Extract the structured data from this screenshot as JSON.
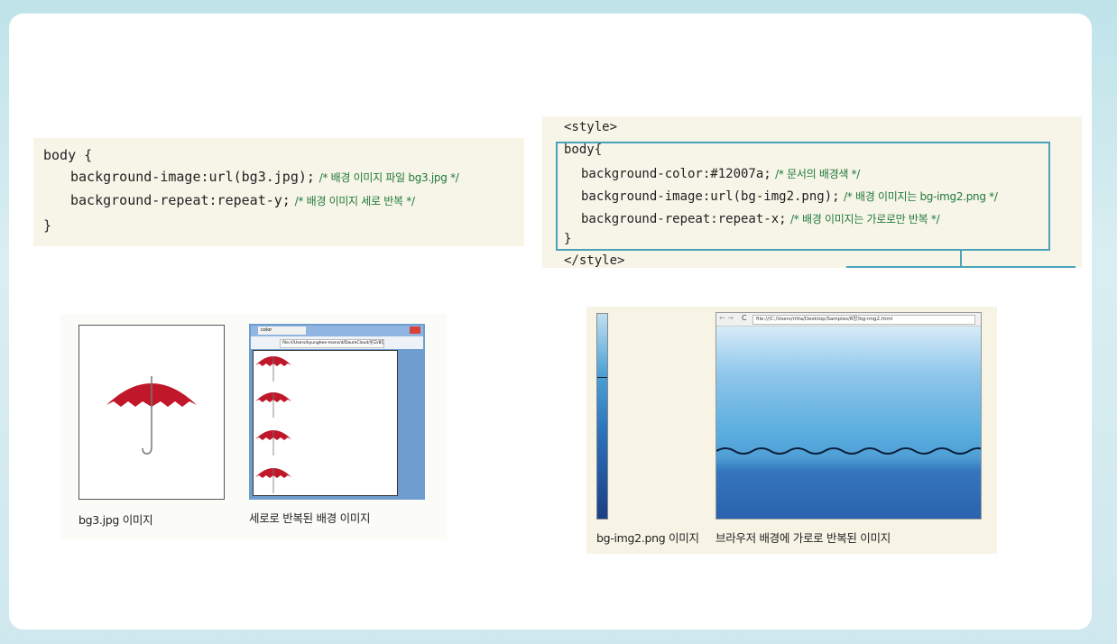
{
  "code_block_1": {
    "line1": "body {",
    "line2_code": "background-image:url(bg3.jpg);",
    "line2_comment": "/* 배경 이미지 파일 bg3.jpg */",
    "line3_code": "background-repeat:repeat-y;",
    "line3_comment": "/* 배경 이미지 세로 반복 */",
    "line4": "}"
  },
  "code_block_2": {
    "open_tag": "<style>",
    "line1": "body{",
    "line2_code": "background-color:#12007a;",
    "line2_comment": "/* 문서의 배경색 */",
    "line3_code": "background-image:url(bg-img2.png);",
    "line3_comment": "/* 배경 이미지는 bg-img2.png */",
    "line4_code": "background-repeat:repeat-x;",
    "line4_comment": "/* 배경 이미지는 가로로만 반복 */",
    "line5": "}",
    "close_tag": "</style>"
  },
  "figures": {
    "bg3_caption": "bg3.jpg 이미지",
    "repeat_y_caption": "세로로 반복된 배경 이미지",
    "bg_img2_caption": "bg-img2.png 이미지",
    "repeat_x_caption": "브라우저 배경에 가로로 반복된 이미지",
    "browser_left_url": "file:///Users/kyunghee-mans/d/DaumCloud/원고/8장/",
    "browser_left_tab": "color",
    "browser_right_url": "file:///C:/Users/ritta/Desktop/Samples/8장/bg-img2.html"
  },
  "colors": {
    "code_bg": "#f7f4e8",
    "comment": "#1f7a3a",
    "tag": "#b03060",
    "frame": "#4aa3b8",
    "umbrella": "#c0182a"
  }
}
